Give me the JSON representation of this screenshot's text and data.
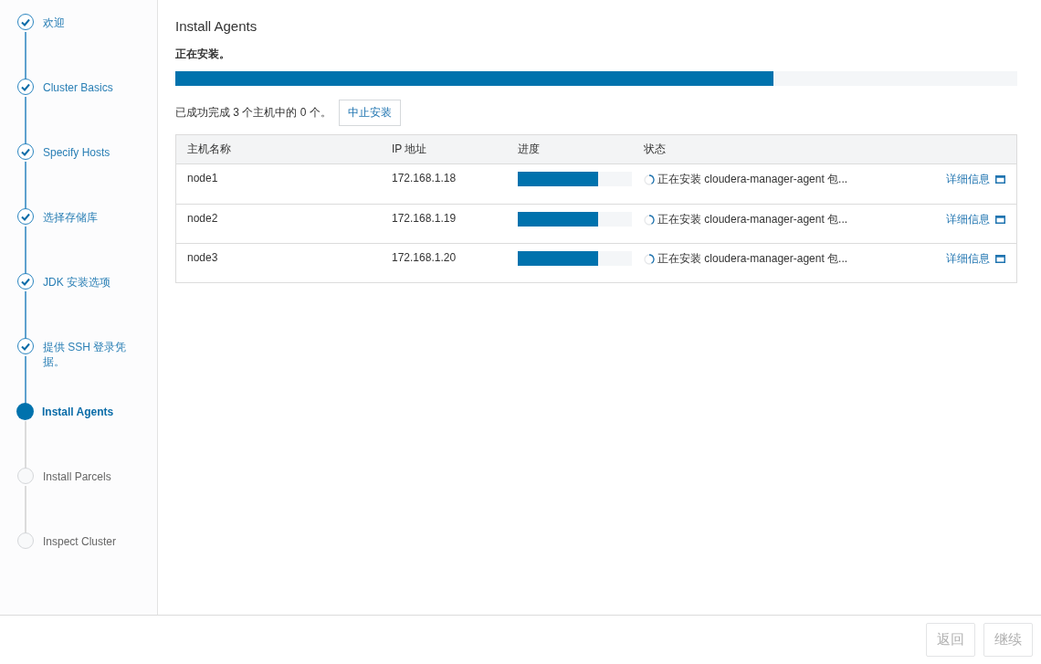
{
  "steps": [
    {
      "label": "欢迎",
      "completed": true,
      "selected": false
    },
    {
      "label": "Cluster Basics",
      "completed": true,
      "selected": false
    },
    {
      "label": "Specify Hosts",
      "completed": true,
      "selected": false
    },
    {
      "label": "选择存储库",
      "completed": true,
      "selected": false
    },
    {
      "label": "JDK 安装选项",
      "completed": true,
      "selected": false
    },
    {
      "label": "提供 SSH 登录凭据。",
      "completed": true,
      "selected": false
    },
    {
      "label": "Install Agents",
      "completed": false,
      "selected": true
    },
    {
      "label": "Install Parcels",
      "completed": false,
      "selected": false
    },
    {
      "label": "Inspect Cluster",
      "completed": false,
      "selected": false
    }
  ],
  "title": "Install Agents",
  "status_text": "正在安装。",
  "overall_progress": {
    "level": 0.71
  },
  "summary": "已成功完成 3 个主机中的 0 个。",
  "abort_button": "中止安装",
  "table": {
    "columns": [
      "主机名称",
      "IP 地址",
      "进度",
      "状态"
    ],
    "rows": [
      {
        "host": "node1",
        "ip": "172.168.1.18",
        "level": 0.7,
        "status": "正在安装 cloudera-manager-agent 包...",
        "details": "详细信息"
      },
      {
        "host": "node2",
        "ip": "172.168.1.19",
        "level": 0.7,
        "status": "正在安装 cloudera-manager-agent 包...",
        "details": "详细信息"
      },
      {
        "host": "node3",
        "ip": "172.168.1.20",
        "level": 0.7,
        "status": "正在安装 cloudera-manager-agent 包...",
        "details": "详细信息"
      }
    ]
  },
  "footer": {
    "buttons": [
      {
        "label": "返回",
        "disabled": true
      },
      {
        "label": "继续",
        "disabled": true
      }
    ]
  }
}
